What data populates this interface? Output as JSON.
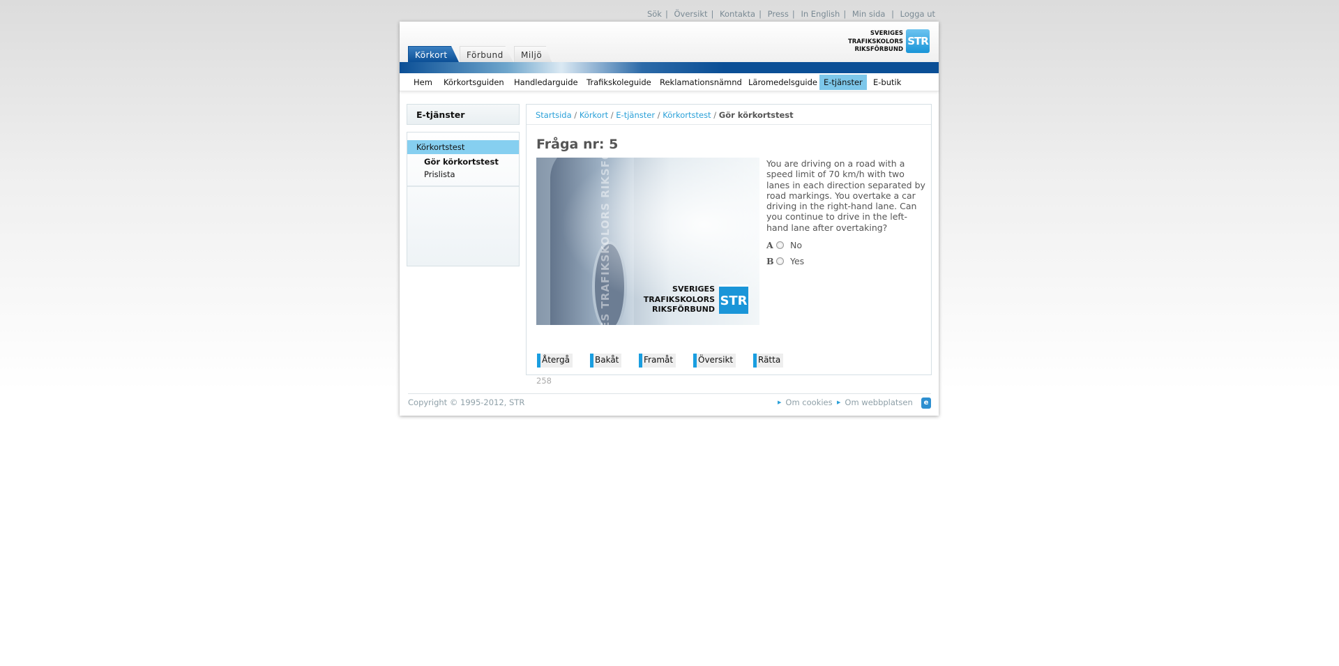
{
  "top_links": [
    "Sök",
    "Översikt",
    "Kontakta",
    "Press",
    "In English",
    "Min sida",
    "Logga ut"
  ],
  "logo": {
    "line1": "SVERIGES",
    "line2": "TRAFIKSKOLORS",
    "line3": "RIKSFÖRBUND",
    "mark": "STR"
  },
  "tabs": [
    {
      "label": "Körkort",
      "active": true
    },
    {
      "label": "Förbund"
    },
    {
      "label": "Miljö"
    }
  ],
  "nav": [
    "Hem",
    "Körkortsguiden",
    "Handledarguide",
    "Trafikskoleguide",
    "Reklamationsnämnd",
    "Läromedelsguide",
    "E-tjänster",
    "E-butik"
  ],
  "nav_active": "E-tjänster",
  "sidebar": {
    "title": "E-tjänster",
    "category": "Körkortstest",
    "items": [
      "Gör körkortstest",
      "Prislista"
    ]
  },
  "breadcrumb": {
    "links": [
      "Startsida",
      "Körkort",
      "E-tjänster",
      "Körkortstest"
    ],
    "current": "Gör körkortstest",
    "sep": "/"
  },
  "question": {
    "title": "Fråga nr: 5",
    "image_watermark": "SVERIGES TRAFIKSKOLORS RIKSFÖRBUND",
    "text": "You are driving on a road with a speed limit of 70 km/h with two lanes in each direction separated by road markings. You overtake a car driving in the right-hand lane. Can you continue to drive in the left-hand lane after overtaking?",
    "options": [
      {
        "letter": "A",
        "label": "No"
      },
      {
        "letter": "B",
        "label": "Yes"
      }
    ]
  },
  "buttons": [
    "Återgå",
    "Bakåt",
    "Framåt",
    "Översikt",
    "Rätta"
  ],
  "count": "258",
  "footer": {
    "copyright": "Copyright © 1995-2012, STR",
    "links": [
      "Om cookies",
      "Om webbplatsen"
    ]
  },
  "colors": {
    "accent": "#1a9ee0",
    "nav_active": "#7dc7ea",
    "brand_blue": "#0b4f96"
  }
}
